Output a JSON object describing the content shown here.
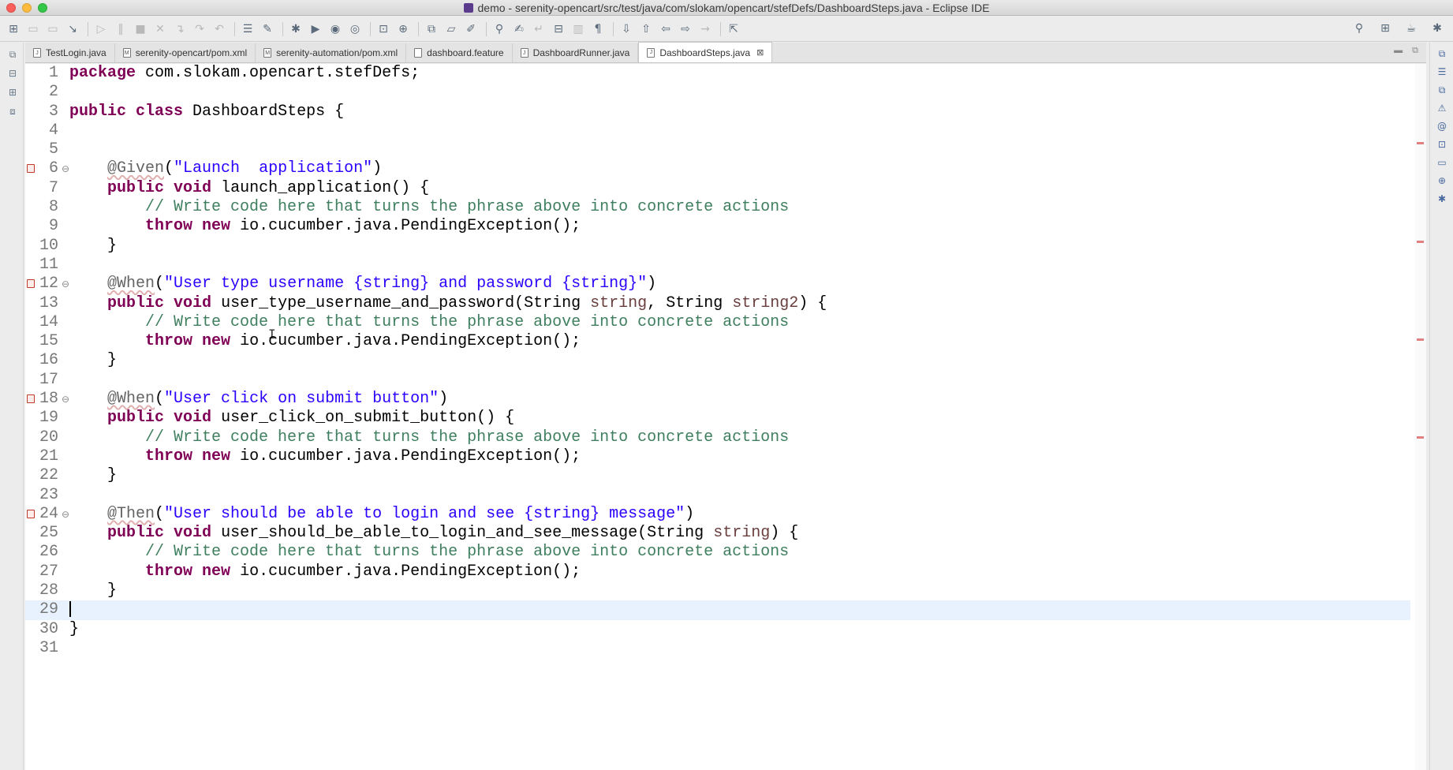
{
  "window": {
    "title": "demo - serenity-opencart/src/test/java/com/slokam/opencart/stefDefs/DashboardSteps.java - Eclipse IDE"
  },
  "toolbar": {
    "icons": [
      "new-icon",
      "save-icon",
      "print-icon",
      "debug-icon",
      "run-icon",
      "coverage-icon",
      "external-tools-icon",
      "new-class-icon",
      "open-type-icon",
      "search-icon",
      "back-icon",
      "forward-icon"
    ]
  },
  "tabs": [
    {
      "label": "TestLogin.java",
      "type": "J"
    },
    {
      "label": "serenity-opencart/pom.xml",
      "type": "M"
    },
    {
      "label": "serenity-automation/pom.xml",
      "type": "M"
    },
    {
      "label": "dashboard.feature",
      "type": ""
    },
    {
      "label": "DashboardRunner.java",
      "type": "J"
    },
    {
      "label": "DashboardSteps.java",
      "type": "J",
      "active": true
    }
  ],
  "code": {
    "lines": [
      {
        "n": "1"
      },
      {
        "n": "2"
      },
      {
        "n": "3"
      },
      {
        "n": "4"
      },
      {
        "n": "5"
      },
      {
        "n": "6"
      },
      {
        "n": "7"
      },
      {
        "n": "8"
      },
      {
        "n": "9"
      },
      {
        "n": "10"
      },
      {
        "n": "11"
      },
      {
        "n": "12"
      },
      {
        "n": "13"
      },
      {
        "n": "14"
      },
      {
        "n": "15"
      },
      {
        "n": "16"
      },
      {
        "n": "17"
      },
      {
        "n": "18"
      },
      {
        "n": "19"
      },
      {
        "n": "20"
      },
      {
        "n": "21"
      },
      {
        "n": "22"
      },
      {
        "n": "23"
      },
      {
        "n": "24"
      },
      {
        "n": "25"
      },
      {
        "n": "26"
      },
      {
        "n": "27"
      },
      {
        "n": "28"
      },
      {
        "n": "29"
      },
      {
        "n": "30"
      },
      {
        "n": "31"
      }
    ],
    "t": {
      "package_kw": "package",
      "package_name": " com.slokam.opencart.stefDefs;",
      "public": "public",
      "class": "class",
      "void": "void",
      "throw": "throw",
      "new": "new",
      "String": "String",
      "class_name": " DashboardSteps {",
      "given": "@Given",
      "when": "@When",
      "then": "@Then",
      "s1": "\"Launch  application\"",
      "s2": "\"User type username {string} and password {string}\"",
      "s3": "\"User click on submit button\"",
      "s4": "\"User should be able to login and see {string} message\"",
      "m1": " launch_application() {",
      "m2": " user_type_username_and_password(",
      "m3": " user_click_on_submit_button() {",
      "m4": " user_should_be_able_to_login_and_see_message(",
      "comment": "// Write code here that turns the phrase above into concrete actions",
      "exc": " io.cucumber.java.PendingException();",
      "p_string": "string",
      "p_string2": "string2",
      "close_brace": "}",
      "open_paren": "(",
      "close_paren": ")",
      "comma_sp": ", ",
      "end_sig": ") {"
    }
  }
}
